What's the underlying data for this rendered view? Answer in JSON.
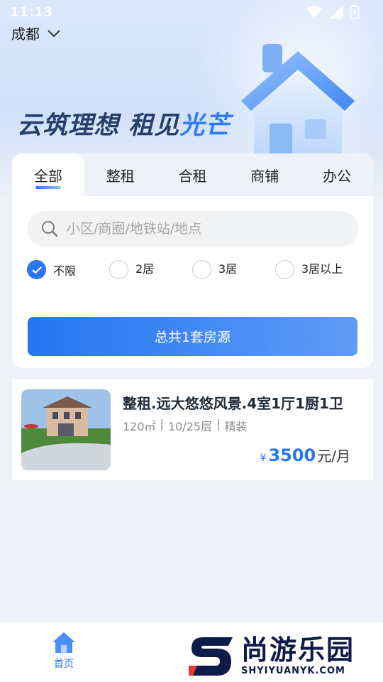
{
  "status_bar": {
    "time": "11:13"
  },
  "header": {
    "city": "成都",
    "slogan_main": "云筑理想 租见",
    "slogan_highlight": "光芒"
  },
  "tabs": [
    {
      "label": "全部",
      "active": true
    },
    {
      "label": "整租",
      "active": false
    },
    {
      "label": "合租",
      "active": false
    },
    {
      "label": "商铺",
      "active": false
    },
    {
      "label": "办公",
      "active": false
    }
  ],
  "search": {
    "placeholder": "小区/商圈/地铁站/地点",
    "value": ""
  },
  "room_options": [
    {
      "label": "不限",
      "checked": true
    },
    {
      "label": "2居",
      "checked": false
    },
    {
      "label": "3居",
      "checked": false
    },
    {
      "label": "3居以上",
      "checked": false
    }
  ],
  "total_button": {
    "label": "总共1套房源"
  },
  "listing": {
    "title": "整租.远大悠悠风景.4室1厅1厨1卫",
    "area": "120㎡",
    "floor": "10/25层",
    "decoration": "精装",
    "currency": "¥",
    "price": "3500",
    "unit": "元/月"
  },
  "bottom_nav": [
    {
      "label": "首页",
      "active": true
    }
  ],
  "watermark": {
    "cn": "尚游乐园",
    "en": "SHYIYUANYK.COM"
  },
  "colors": {
    "accent": "#2b76f5",
    "title_dark": "#24406b",
    "background": "#eef1f5"
  }
}
